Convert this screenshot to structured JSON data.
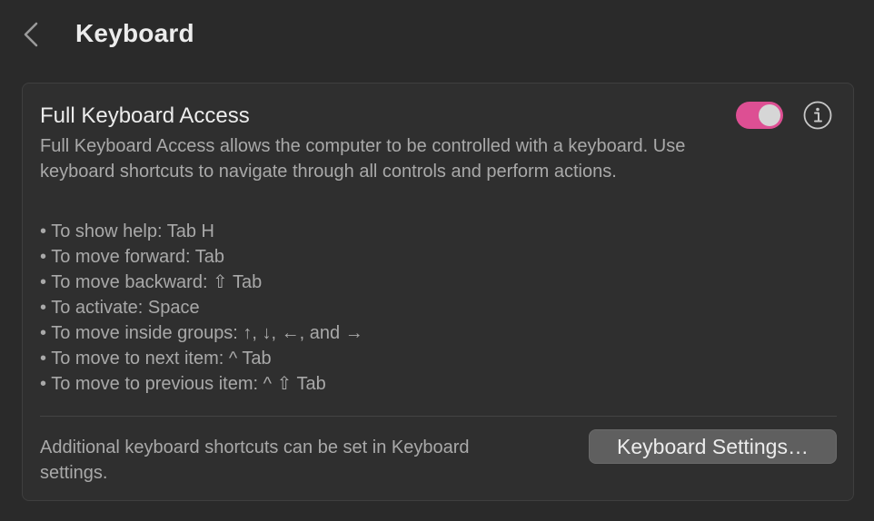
{
  "header": {
    "title": "Keyboard",
    "back_icon": "chevron-left-icon"
  },
  "card": {
    "title": "Full Keyboard Access",
    "toggle": {
      "state": "on",
      "color": "#dd4f93"
    },
    "info_icon": "info-circle-icon",
    "description": "Full Keyboard Access allows the computer to be controlled with a keyboard. Use keyboard shortcuts to navigate through all controls and perform actions.",
    "shortcuts": [
      "To show help: Tab H",
      "To move forward: Tab",
      "To move backward: ⇧ Tab",
      "To activate: Space",
      "To move inside groups: ↑, ↓, ←, and →",
      "To move to next item: ^ Tab",
      "To move to previous item: ^ ⇧ Tab"
    ],
    "footer_note": "Additional keyboard shortcuts can be set in Keyboard settings.",
    "settings_button_label": "Keyboard Settings…"
  }
}
